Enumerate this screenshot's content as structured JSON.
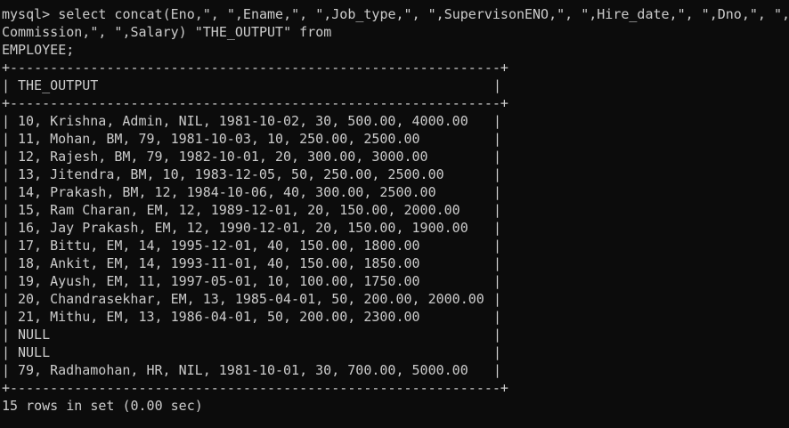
{
  "command": {
    "lines": [
      "mysql> select concat(Eno,\", \",Ename,\", \",Job_type,\", \",SupervisonENO,\", \",Hire_date,\", \",Dno,\", \",",
      "Commission,\", \",Salary) \"THE_OUTPUT\" from",
      "EMPLOYEE;"
    ]
  },
  "table": {
    "border": "+-------------------------------------------------------------+",
    "pipe": "|",
    "header": "THE_OUTPUT",
    "rows": [
      "10, Krishna, Admin, NIL, 1981-10-02, 30, 500.00, 4000.00",
      "11, Mohan, BM, 79, 1981-10-03, 10, 250.00, 2500.00",
      "12, Rajesh, BM, 79, 1982-10-01, 20, 300.00, 3000.00",
      "13, Jitendra, BM, 10, 1983-12-05, 50, 250.00, 2500.00",
      "14, Prakash, BM, 12, 1984-10-06, 40, 300.00, 2500.00",
      "15, Ram Charan, EM, 12, 1989-12-01, 20, 150.00, 2000.00",
      "16, Jay Prakash, EM, 12, 1990-12-01, 20, 150.00, 1900.00",
      "17, Bittu, EM, 14, 1995-12-01, 40, 150.00, 1800.00",
      "18, Ankit, EM, 14, 1993-11-01, 40, 150.00, 1850.00",
      "19, Ayush, EM, 11, 1997-05-01, 10, 100.00, 1750.00",
      "20, Chandrasekhar, EM, 13, 1985-04-01, 50, 200.00, 2000.00",
      "21, Mithu, EM, 13, 1986-04-01, 50, 200.00, 2300.00",
      "NULL",
      "NULL",
      "79, Radhamohan, HR, NIL, 1981-10-01, 30, 700.00, 5000.00"
    ]
  },
  "status": "15 rows in set (0.00 sec)",
  "colors": {
    "background": "#0c0c0c",
    "text": "#cccccc"
  }
}
